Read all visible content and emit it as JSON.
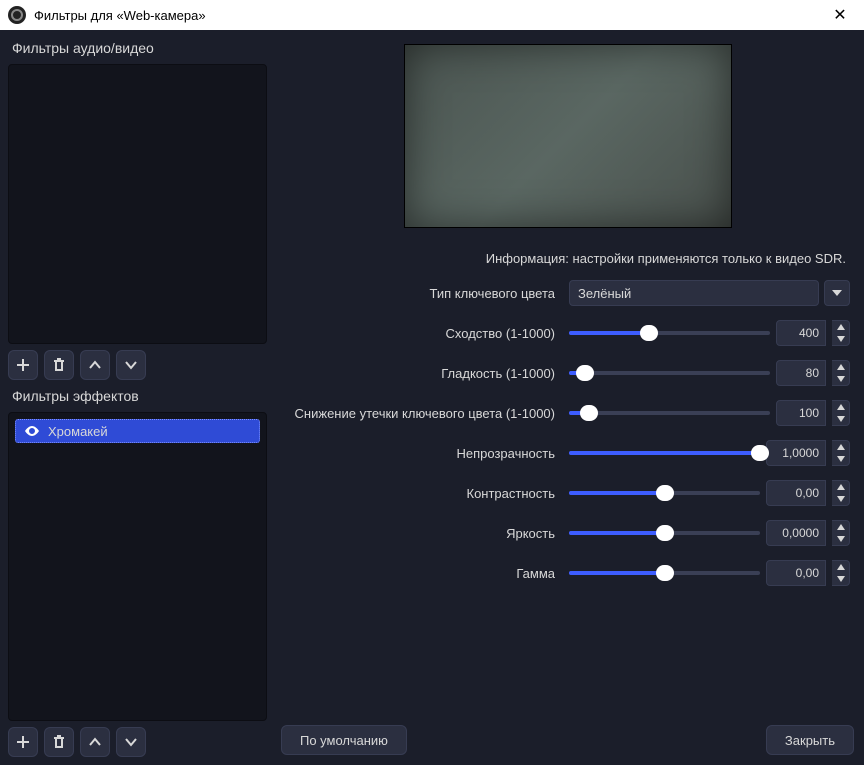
{
  "titlebar": {
    "title": "Фильтры для «Web-камера»"
  },
  "leftPanel": {
    "avLabel": "Фильтры аудио/видео",
    "fxLabel": "Фильтры эффектов",
    "filters": [
      {
        "name": "Хромакей",
        "selected": true
      }
    ]
  },
  "settings": {
    "info": "Информация: настройки применяются только к видео SDR.",
    "keyTypeLabel": "Тип ключевого цвета",
    "keyTypeValue": "Зелёный",
    "rows": [
      {
        "label": "Сходство (1-1000)",
        "value": "400",
        "pct": 40,
        "wide": false
      },
      {
        "label": "Гладкость (1-1000)",
        "value": "80",
        "pct": 8,
        "wide": false
      },
      {
        "label": "Снижение утечки ключевого цвета (1-1000)",
        "value": "100",
        "pct": 10,
        "wide": false
      },
      {
        "label": "Непрозрачность",
        "value": "1,0000",
        "pct": 100,
        "wide": true
      },
      {
        "label": "Контрастность",
        "value": "0,00",
        "pct": 50,
        "wide": true
      },
      {
        "label": "Яркость",
        "value": "0,0000",
        "pct": 50,
        "wide": true
      },
      {
        "label": "Гамма",
        "value": "0,00",
        "pct": 50,
        "wide": true
      }
    ]
  },
  "footer": {
    "defaults": "По умолчанию",
    "close": "Закрыть"
  }
}
